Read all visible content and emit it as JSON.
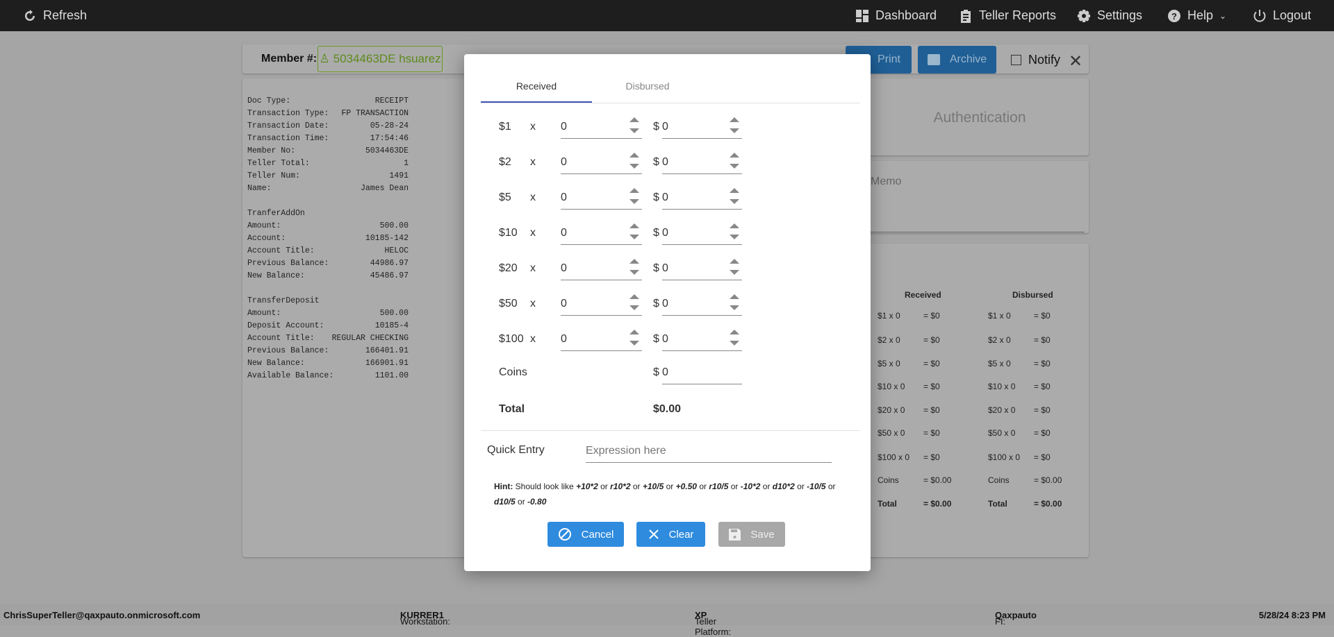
{
  "topbar": {
    "refresh": "Refresh",
    "dashboard": "Dashboard",
    "teller_reports": "Teller Reports",
    "settings": "Settings",
    "help": "Help",
    "logout": "Logout"
  },
  "header": {
    "member_label": "Member #:",
    "member_value": "5034463DE hsuarez",
    "print": "Print",
    "archive": "Archive",
    "notify": "Notify"
  },
  "receipt": [
    [
      "Doc Type:",
      "RECEIPT"
    ],
    [
      "Transaction Type:",
      "FP TRANSACTION"
    ],
    [
      "Transaction Date:",
      "05-28-24"
    ],
    [
      "Transaction Time:",
      "17:54:46"
    ],
    [
      "Member No:",
      "5034463DE"
    ],
    [
      "Teller Total:",
      "1"
    ],
    [
      "Teller Num:",
      "1491"
    ],
    [
      "Name:",
      "James Dean"
    ],
    [
      "",
      ""
    ],
    [
      "TranferAddOn",
      ""
    ],
    [
      "Amount:",
      "500.00"
    ],
    [
      "Account:",
      "10185-142"
    ],
    [
      "Account Title:",
      "HELOC"
    ],
    [
      "Previous Balance:",
      "44986.97"
    ],
    [
      "New Balance:",
      "45486.97"
    ],
    [
      "",
      ""
    ],
    [
      "TransferDeposit",
      ""
    ],
    [
      "Amount:",
      "500.00"
    ],
    [
      "Deposit Account:",
      "10185-4"
    ],
    [
      "Account Title:",
      "REGULAR CHECKING"
    ],
    [
      "Previous Balance:",
      "166401.91"
    ],
    [
      "New Balance:",
      "166901.91"
    ],
    [
      "Available Balance:",
      "1101.00"
    ]
  ],
  "right": {
    "authentication": "Authentication",
    "memo": "Memo",
    "received_header": "Received",
    "disbursed_header": "Disbursed",
    "received": [
      [
        "$1 x 0",
        "= $0"
      ],
      [
        "$2 x 0",
        "= $0"
      ],
      [
        "$5 x 0",
        "= $0"
      ],
      [
        "$10 x 0",
        "= $0"
      ],
      [
        "$20 x 0",
        "= $0"
      ],
      [
        "$50 x 0",
        "= $0"
      ],
      [
        "$100 x 0",
        "= $0"
      ],
      [
        "Coins",
        "= $0.00"
      ],
      [
        "Total",
        "= $0.00"
      ]
    ],
    "disbursed": [
      [
        "$1 x 0",
        "= $0"
      ],
      [
        "$2 x 0",
        "= $0"
      ],
      [
        "$5 x 0",
        "= $0"
      ],
      [
        "$10 x 0",
        "= $0"
      ],
      [
        "$20 x 0",
        "= $0"
      ],
      [
        "$50 x 0",
        "= $0"
      ],
      [
        "$100 x 0",
        "= $0"
      ],
      [
        "Coins",
        "= $0.00"
      ],
      [
        "Total",
        "= $0.00"
      ]
    ]
  },
  "modal": {
    "tabs": [
      {
        "label": "Received",
        "active": true
      },
      {
        "label": "Disbursed",
        "active": false
      }
    ],
    "x": "x",
    "currency": "$",
    "rows": [
      {
        "den": "$1",
        "qty": "0",
        "amount": "0"
      },
      {
        "den": "$2",
        "qty": "0",
        "amount": "0"
      },
      {
        "den": "$5",
        "qty": "0",
        "amount": "0"
      },
      {
        "den": "$10",
        "qty": "0",
        "amount": "0"
      },
      {
        "den": "$20",
        "qty": "0",
        "amount": "0"
      },
      {
        "den": "$50",
        "qty": "0",
        "amount": "0"
      },
      {
        "den": "$100",
        "qty": "0",
        "amount": "0"
      }
    ],
    "coins_label": "Coins",
    "coins_value": "0",
    "total_label": "Total",
    "total_value": "$0.00",
    "quick_entry_label": "Quick Entry",
    "quick_entry_placeholder": "Expression here",
    "hint_label": "Hint:",
    "hint_intro": "Should look like",
    "hint_examples": [
      "+10*2",
      "r10*2",
      "+10/5",
      "+0.50",
      "r10/5",
      "-10*2",
      "d10*2",
      "-10/5",
      "d10/5",
      "-0.80"
    ],
    "hint_sep": "or",
    "cancel": "Cancel",
    "clear": "Clear",
    "save": "Save"
  },
  "footer": {
    "user": "ChrisSuperTeller@qaxpauto.onmicrosoft.com",
    "workstation_label": "Workstation:",
    "workstation": "KURRER1",
    "platform_label": "Teller Platform:",
    "platform": "XP",
    "fi_label": "FI:",
    "fi": "Qaxpauto",
    "datetime": "5/28/24 8:23 PM"
  },
  "colors": {
    "primary": "#2e8bde",
    "disabled": "#a8a8a8",
    "tab_active": "#3f51b5",
    "member_green": "#5d8a1c"
  }
}
